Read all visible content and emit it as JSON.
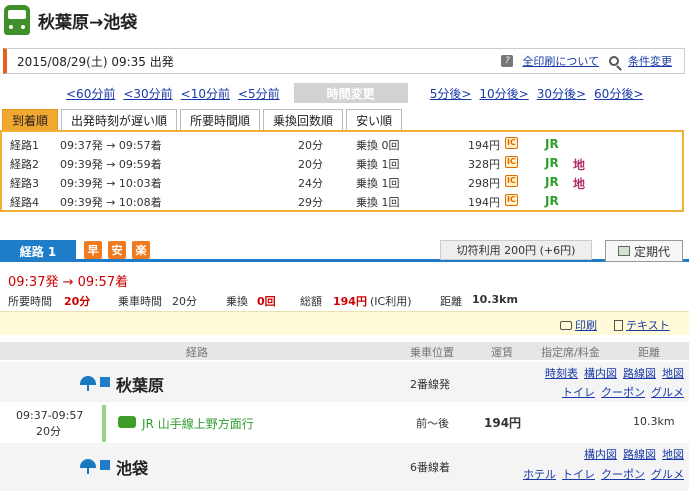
{
  "title": "秋葉原→池袋",
  "datebar": {
    "datetime": "2015/08/29(土) 09:35 出発",
    "print_all": "全印刷について",
    "conditions": "条件変更"
  },
  "timechange": {
    "before": [
      "<60分前",
      "<30分前",
      "<10分前",
      "<5分前"
    ],
    "label": "時間変更",
    "after": [
      "5分後>",
      "10分後>",
      "30分後>",
      "60分後>"
    ]
  },
  "tabs": [
    "到着順",
    "出発時刻が遅い順",
    "所要時間順",
    "乗換回数順",
    "安い順"
  ],
  "routes": [
    {
      "name": "経路1",
      "time": "09:37発 → 09:57着",
      "duration": "20分",
      "transfer": "乗換 0回",
      "fare": "194円",
      "ic": "IC",
      "jr": "JR",
      "chika": ""
    },
    {
      "name": "経路2",
      "time": "09:39発 → 09:59着",
      "duration": "20分",
      "transfer": "乗換 1回",
      "fare": "328円",
      "ic": "IC",
      "jr": "JR",
      "chika": "地"
    },
    {
      "name": "経路3",
      "time": "09:39発 → 10:03着",
      "duration": "24分",
      "transfer": "乗換 1回",
      "fare": "298円",
      "ic": "IC",
      "jr": "JR",
      "chika": "地"
    },
    {
      "name": "経路4",
      "time": "09:39発 → 10:08着",
      "duration": "29分",
      "transfer": "乗換 1回",
      "fare": "194円",
      "ic": "IC",
      "jr": "JR",
      "chika": ""
    }
  ],
  "route1": {
    "tab": "経路 1",
    "badges": [
      "早",
      "安",
      "楽"
    ],
    "fare_note": "切符利用 200円 (+6円)",
    "teiki": "定期代",
    "time": "09:37発 → 09:57着",
    "labels": {
      "total": "所要時間",
      "ride": "乗車時間",
      "transfer": "乗換",
      "fare": "総額",
      "distance": "距離"
    },
    "values": {
      "total": "20分",
      "ride": "20分",
      "transfer": "0回",
      "fare": "194円",
      "fare_note": "(IC利用)",
      "distance": "10.3km"
    },
    "print": "印刷",
    "text": "テキスト"
  },
  "table": {
    "headers": [
      "経路",
      "乗車位置",
      "運賃",
      "指定席/料金",
      "距離"
    ],
    "dep": {
      "name": "秋葉原",
      "platform": "2番線発",
      "links1": [
        "時刻表",
        "構内図",
        "路線図",
        "地図"
      ],
      "links2": [
        "トイレ",
        "クーポン",
        "グルメ"
      ]
    },
    "seg": {
      "time": "09:37-09:57",
      "dur": "20分",
      "line": "JR 山手線上野方面行",
      "pos": "前〜後",
      "fare": "194円",
      "dist": "10.3km"
    },
    "arr": {
      "name": "池袋",
      "platform": "6番線着",
      "links1": [
        "構内図",
        "路線図",
        "地図"
      ],
      "links2": [
        "ホテル",
        "トイレ",
        "クーポン",
        "グルメ"
      ]
    }
  }
}
